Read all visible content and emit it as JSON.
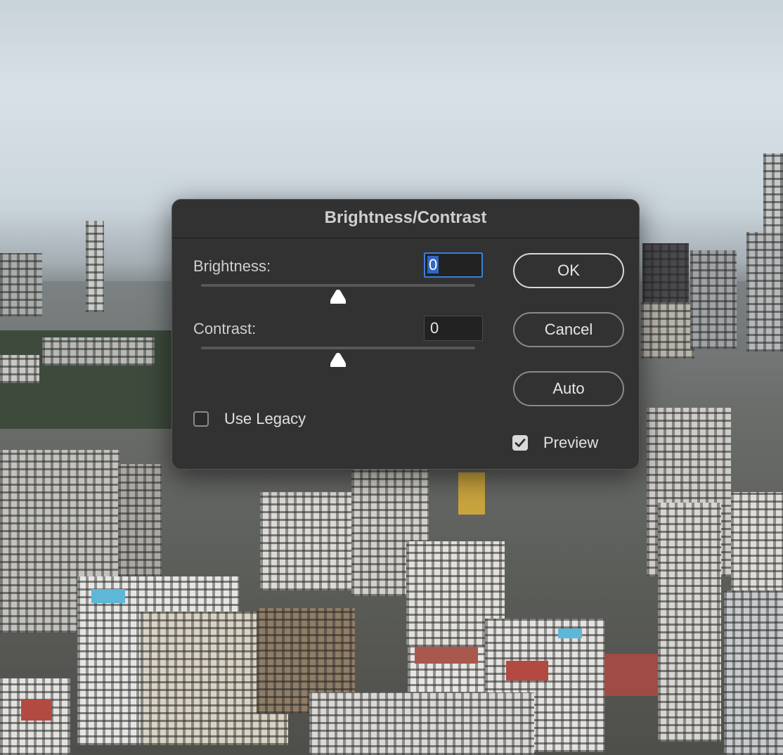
{
  "dialog": {
    "title": "Brightness/Contrast",
    "brightness": {
      "label": "Brightness:",
      "value": "0"
    },
    "contrast": {
      "label": "Contrast:",
      "value": "0"
    },
    "buttons": {
      "ok": "OK",
      "cancel": "Cancel",
      "auto": "Auto"
    },
    "use_legacy": {
      "label": "Use Legacy",
      "checked": false
    },
    "preview": {
      "label": "Preview",
      "checked": true
    }
  },
  "colors": {
    "dialog_bg": "#323232",
    "focus_ring": "#3b7ddd"
  }
}
